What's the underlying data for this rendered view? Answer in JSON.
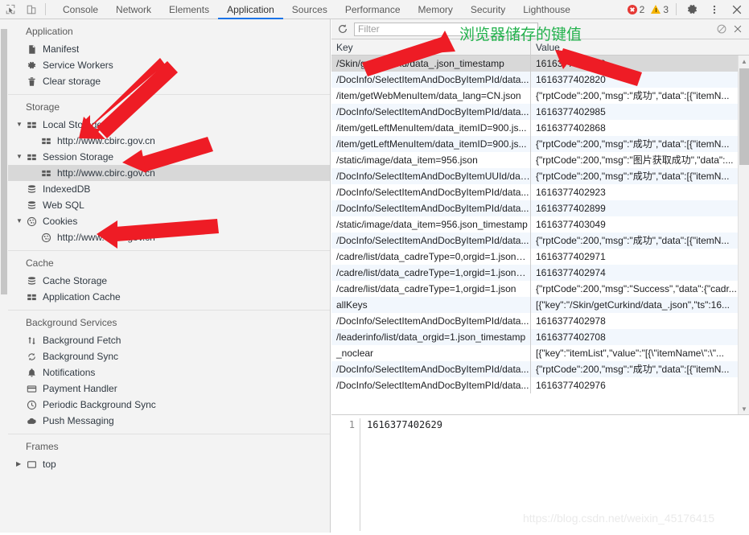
{
  "toolbar": {
    "icons": [
      {
        "name": "inspect-element-icon",
        "glyph": "inspect"
      },
      {
        "name": "device-toolbar-icon",
        "glyph": "device"
      }
    ],
    "tabs": [
      {
        "label": "Console",
        "active": false
      },
      {
        "label": "Network",
        "active": false
      },
      {
        "label": "Elements",
        "active": false
      },
      {
        "label": "Application",
        "active": true
      },
      {
        "label": "Sources",
        "active": false
      },
      {
        "label": "Performance",
        "active": false
      },
      {
        "label": "Memory",
        "active": false
      },
      {
        "label": "Security",
        "active": false
      },
      {
        "label": "Lighthouse",
        "active": false
      }
    ],
    "error_count": "2",
    "warning_count": "3",
    "settings_label": "Settings",
    "more_label": "More options",
    "close_label": "Close"
  },
  "sidebar": {
    "sections": [
      {
        "title": "Application",
        "items": [
          {
            "label": "Manifest",
            "icon": "manifest-document-icon",
            "indent": 1,
            "selected": false,
            "twisty": ""
          },
          {
            "label": "Service Workers",
            "icon": "gear-icon",
            "indent": 1,
            "selected": false,
            "twisty": ""
          },
          {
            "label": "Clear storage",
            "icon": "trash-icon",
            "indent": 1,
            "selected": false,
            "twisty": ""
          }
        ]
      },
      {
        "title": "Storage",
        "items": [
          {
            "label": "Local Storage",
            "icon": "storage-table-icon",
            "indent": 1,
            "selected": false,
            "twisty": "open"
          },
          {
            "label": "http://www.cbirc.gov.cn",
            "icon": "storage-table-icon",
            "indent": 2,
            "selected": false,
            "twisty": ""
          },
          {
            "label": "Session Storage",
            "icon": "storage-table-icon",
            "indent": 1,
            "selected": false,
            "twisty": "open"
          },
          {
            "label": "http://www.cbirc.gov.cn",
            "icon": "storage-table-icon",
            "indent": 2,
            "selected": true,
            "twisty": ""
          },
          {
            "label": "IndexedDB",
            "icon": "database-icon",
            "indent": 1,
            "selected": false,
            "twisty": ""
          },
          {
            "label": "Web SQL",
            "icon": "database-icon",
            "indent": 1,
            "selected": false,
            "twisty": ""
          },
          {
            "label": "Cookies",
            "icon": "cookie-icon",
            "indent": 1,
            "selected": false,
            "twisty": "open"
          },
          {
            "label": "http://www.cbirc.gov.cn",
            "icon": "cookie-icon",
            "indent": 2,
            "selected": false,
            "twisty": ""
          }
        ]
      },
      {
        "title": "Cache",
        "items": [
          {
            "label": "Cache Storage",
            "icon": "database-icon",
            "indent": 1,
            "selected": false,
            "twisty": ""
          },
          {
            "label": "Application Cache",
            "icon": "storage-table-icon",
            "indent": 1,
            "selected": false,
            "twisty": ""
          }
        ]
      },
      {
        "title": "Background Services",
        "items": [
          {
            "label": "Background Fetch",
            "icon": "updown-arrows-icon",
            "indent": 1,
            "selected": false,
            "twisty": ""
          },
          {
            "label": "Background Sync",
            "icon": "sync-icon",
            "indent": 1,
            "selected": false,
            "twisty": ""
          },
          {
            "label": "Notifications",
            "icon": "bell-icon",
            "indent": 1,
            "selected": false,
            "twisty": ""
          },
          {
            "label": "Payment Handler",
            "icon": "credit-card-icon",
            "indent": 1,
            "selected": false,
            "twisty": ""
          },
          {
            "label": "Periodic Background Sync",
            "icon": "clock-icon",
            "indent": 1,
            "selected": false,
            "twisty": ""
          },
          {
            "label": "Push Messaging",
            "icon": "cloud-icon",
            "indent": 1,
            "selected": false,
            "twisty": ""
          }
        ]
      },
      {
        "title": "Frames",
        "items": [
          {
            "label": "top",
            "icon": "frame-icon",
            "indent": 1,
            "selected": false,
            "twisty": "closed"
          }
        ]
      }
    ]
  },
  "filterbar": {
    "refresh_label": "Refresh",
    "placeholder": "Filter",
    "value": "",
    "clear_label": "Clear",
    "close_label": "Close"
  },
  "table": {
    "columns": [
      "Key",
      "Value"
    ],
    "rows": [
      {
        "key": "/Skin/getCurkind/data_.json_timestamp",
        "value": "1616377402629",
        "selected": true
      },
      {
        "key": "/DocInfo/SelectItemAndDocByItemPId/data...",
        "value": "1616377402820",
        "selected": false
      },
      {
        "key": "/item/getWebMenuItem/data_lang=CN.json",
        "value": "{\"rptCode\":200,\"msg\":\"成功\",\"data\":[{\"itemN...",
        "selected": false
      },
      {
        "key": "/DocInfo/SelectItemAndDocByItemPId/data...",
        "value": "1616377402985",
        "selected": false
      },
      {
        "key": "/item/getLeftMenuItem/data_itemID=900.js...",
        "value": "1616377402868",
        "selected": false
      },
      {
        "key": "/item/getLeftMenuItem/data_itemID=900.js...",
        "value": "{\"rptCode\":200,\"msg\":\"成功\",\"data\":[{\"itemN...",
        "selected": false
      },
      {
        "key": "/static/image/data_item=956.json",
        "value": "{\"rptCode\":200,\"msg\":\"图片获取成功\",\"data\":...",
        "selected": false
      },
      {
        "key": "/DocInfo/SelectItemAndDocByItemUUId/dat...",
        "value": "{\"rptCode\":200,\"msg\":\"成功\",\"data\":[{\"itemN...",
        "selected": false
      },
      {
        "key": "/DocInfo/SelectItemAndDocByItemPId/data...",
        "value": "1616377402923",
        "selected": false
      },
      {
        "key": "/DocInfo/SelectItemAndDocByItemPId/data...",
        "value": "1616377402899",
        "selected": false
      },
      {
        "key": "/static/image/data_item=956.json_timestamp",
        "value": "1616377403049",
        "selected": false
      },
      {
        "key": "/DocInfo/SelectItemAndDocByItemPId/data...",
        "value": "{\"rptCode\":200,\"msg\":\"成功\",\"data\":[{\"itemN...",
        "selected": false
      },
      {
        "key": "/cadre/list/data_cadreType=0,orgid=1.json_t...",
        "value": "1616377402971",
        "selected": false
      },
      {
        "key": "/cadre/list/data_cadreType=1,orgid=1.json_t...",
        "value": "1616377402974",
        "selected": false
      },
      {
        "key": "/cadre/list/data_cadreType=1,orgid=1.json",
        "value": "{\"rptCode\":200,\"msg\":\"Success\",\"data\":{\"cadr...",
        "selected": false
      },
      {
        "key": "allKeys",
        "value": "[{\"key\":\"/Skin/getCurkind/data_.json\",\"ts\":16...",
        "selected": false
      },
      {
        "key": "/DocInfo/SelectItemAndDocByItemPId/data...",
        "value": "1616377402978",
        "selected": false
      },
      {
        "key": "/leaderinfo/list/data_orgid=1.json_timestamp",
        "value": "1616377402708",
        "selected": false
      },
      {
        "key": "_noclear",
        "value": "[{\"key\":\"itemList\",\"value\":\"[{\\\"itemName\\\":\\\"...",
        "selected": false
      },
      {
        "key": "/DocInfo/SelectItemAndDocByItemPId/data...",
        "value": "{\"rptCode\":200,\"msg\":\"成功\",\"data\":[{\"itemN...",
        "selected": false
      },
      {
        "key": "/DocInfo/SelectItemAndDocByItemPId/data...",
        "value": "1616377402976",
        "selected": false
      }
    ]
  },
  "preview": {
    "line_number": "1",
    "content": "1616377402629"
  },
  "annotations": {
    "chinese_note": "浏览器储存的键值",
    "note_color": "#22b14c",
    "arrow_color": "#ee1c25",
    "watermark": "https://blog.csdn.net/weixin_45176415"
  }
}
